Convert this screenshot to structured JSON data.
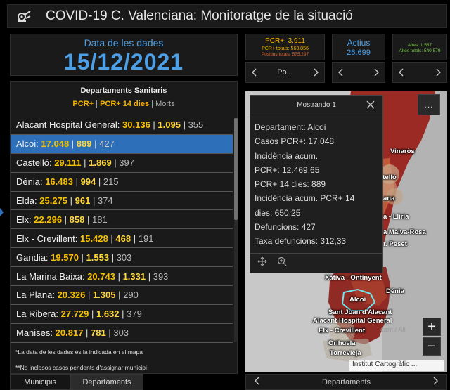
{
  "app": {
    "title": "COVID-19 C. Valenciana: Monitoratge de la situació",
    "logo_icon": "virus-stats-icon"
  },
  "date_panel": {
    "label": "Data de les dades",
    "value": "15/12/2021"
  },
  "stats": {
    "pcr": {
      "line1": "PCR+: 3.911",
      "line2": "PCR+ totals: 563.856",
      "line3": "Positius totals: 575.297",
      "pager_label": "Po..."
    },
    "actius": {
      "label": "Actius",
      "value": "26.699"
    },
    "altes": {
      "line1": "Altes: 1.587",
      "line2": "Altes totals: 540.579"
    }
  },
  "list": {
    "title": "Departaments Sanitaris",
    "subtitle_a": "PCR+",
    "subtitle_b": "PCR+ 14 dies",
    "subtitle_c": "Morts",
    "rows": [
      {
        "name": "Alacant Hospital General:",
        "a": "30.136",
        "b": "1.095",
        "c": "355"
      },
      {
        "name": "Alcoi:",
        "a": "17.048",
        "b": "889",
        "c": "427",
        "selected": true
      },
      {
        "name": "Castelló:",
        "a": "29.111",
        "b": "1.869",
        "c": "397"
      },
      {
        "name": "Dénia:",
        "a": "16.483",
        "b": "994",
        "c": "215"
      },
      {
        "name": "Elda:",
        "a": "25.275",
        "b": "961",
        "c": "374"
      },
      {
        "name": "Elx:",
        "a": "22.296",
        "b": "858",
        "c": "181"
      },
      {
        "name": "Elx - Crevillent:",
        "a": "15.428",
        "b": "468",
        "c": "191"
      },
      {
        "name": "Gandia:",
        "a": "19.570",
        "b": "1.553",
        "c": "303"
      },
      {
        "name": "La Marina Baixa:",
        "a": "20.743",
        "b": "1.331",
        "c": "393"
      },
      {
        "name": "La Plana:",
        "a": "20.326",
        "b": "1.305",
        "c": "290"
      },
      {
        "name": "La Ribera:",
        "a": "27.729",
        "b": "1.632",
        "c": "379"
      },
      {
        "name": "Manises:",
        "a": "20.817",
        "b": "781",
        "c": "303"
      }
    ],
    "note1": "*La data de les dades és la indicada en el mapa",
    "note2": "**No inclosos casos pendents d'assignar municipi"
  },
  "popup": {
    "header": "Mostrando 1",
    "lines": [
      "Departament: Alcoi",
      "Casos PCR+: 17.048",
      "Incidència acum.",
      "PCR+: 12.469,65",
      "PCR+ 14 dies: 889",
      "Incidència acum. PCR+ 14",
      "dies: 650,25",
      "Defuncions: 427",
      "Taxa defuncions: 312,33"
    ]
  },
  "map": {
    "labels": {
      "vinaros": "Vinaròs",
      "castello": "stelló",
      "llana": "ana",
      "lliria": "a - Llíria",
      "malva": "a Malva-Rosa",
      "peset": "r. Peset",
      "xativa": "Xàtiva - Ontinyent",
      "denia": "Dénia",
      "alcoi": "Alcoi",
      "santjoan": "Sant Joan d'Alacant",
      "alacant": "Alacant Hospital General",
      "elxcrev": "Elx - Crevillent",
      "alacant_dim": "cant / Ali",
      "orihuela": "Orihuela",
      "torrevieja": "Torrevieja"
    },
    "more_label": "...",
    "zoom_in": "+",
    "zoom_out": "−",
    "attribution": "Institut Cartogràfic ..."
  },
  "tabs": {
    "municipis": "Municipis",
    "departaments": "Departaments"
  },
  "bottom_pager": {
    "label": "Departaments"
  },
  "colors": {
    "accent_blue": "#4ea0e6",
    "pcr_yellow": "#f5b400",
    "altes_green": "#7ac943",
    "selected_row": "#2d6fb8",
    "map_red": "#a8302a"
  }
}
